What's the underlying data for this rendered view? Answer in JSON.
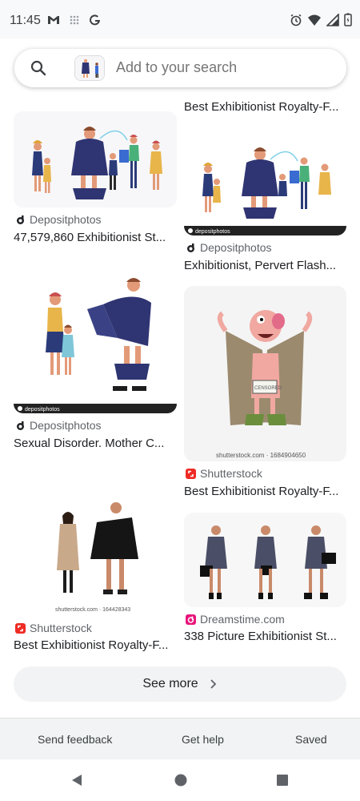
{
  "status_bar": {
    "time": "11:45",
    "left_icons": [
      "gmail-icon",
      "grid-icon",
      "google-icon"
    ],
    "right_icons": [
      "alarm-icon",
      "wifi-icon",
      "signal-icon",
      "battery-icon"
    ]
  },
  "search": {
    "placeholder": "Add to your search"
  },
  "results": [
    {
      "caption": "Best Exhibitionist Royalty-F..."
    },
    {
      "source": "Depositphotos",
      "caption": "47,579,860 Exhibitionist St...",
      "source_icon": "depositphotos-icon"
    },
    {
      "source": "Depositphotos",
      "caption": "Exhibitionist, Pervert Flash...",
      "source_icon": "depositphotos-icon",
      "watermark": "depositphotos"
    },
    {
      "source": "Depositphotos",
      "caption": "Sexual Disorder. Mother C...",
      "source_icon": "depositphotos-icon",
      "watermark": "depositphotos"
    },
    {
      "source": "Shutterstock",
      "caption": "Best Exhibitionist Royalty-F...",
      "source_icon": "shutterstock-icon",
      "watermark": "shutterstock.com · 1684904650",
      "sign_text": "CENSORED"
    },
    {
      "source": "Shutterstock",
      "caption": "Best Exhibitionist Royalty-F...",
      "source_icon": "shutterstock-icon",
      "watermark": "shutterstock.com · 164428343"
    },
    {
      "source": "Dreamstime.com",
      "caption": "338 Picture Exhibitionist St...",
      "source_icon": "dreamstime-icon"
    }
  ],
  "see_more": {
    "label": "See more"
  },
  "footer": {
    "send_feedback": "Send feedback",
    "get_help": "Get help",
    "saved": "Saved"
  },
  "colors": {
    "shutterstock": "#ee2b24",
    "dreamstime": "#e8157a",
    "depositphotos": "#202124",
    "coat": "#2f3472"
  }
}
